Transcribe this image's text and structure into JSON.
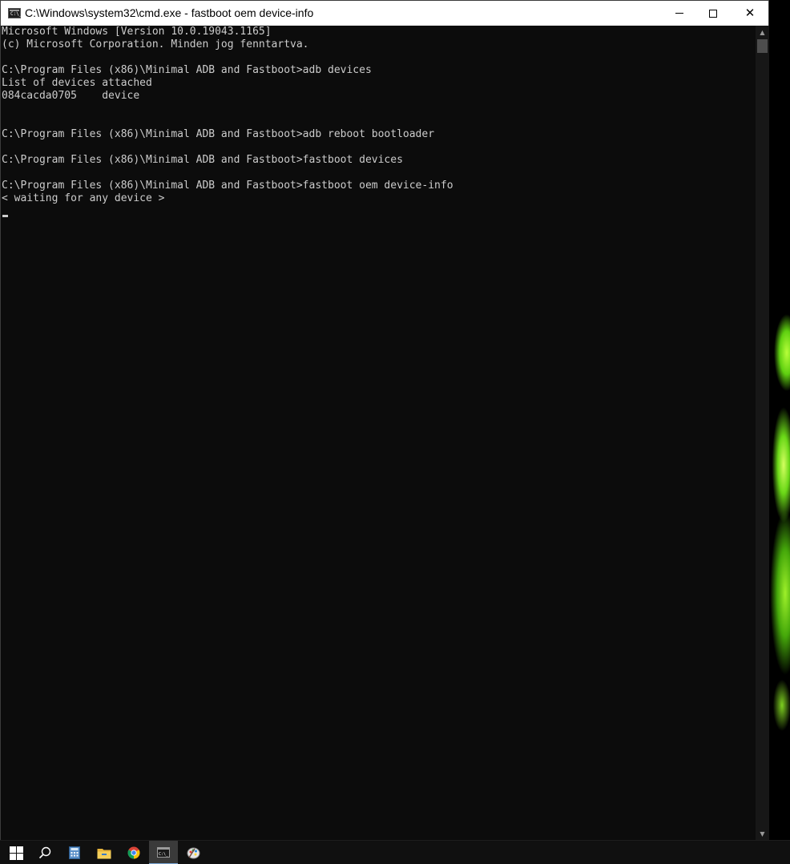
{
  "window": {
    "title": "C:\\Windows\\system32\\cmd.exe - fastboot  oem device-info",
    "app_icon_text": "C:\\_",
    "minimize_glyph": "",
    "close_glyph": "✕"
  },
  "console": {
    "lines": [
      "Microsoft Windows [Version 10.0.19043.1165]",
      "(c) Microsoft Corporation. Minden jog fenntartva.",
      "",
      "C:\\Program Files (x86)\\Minimal ADB and Fastboot>adb devices",
      "List of devices attached",
      "084cacda0705    device",
      "",
      "",
      "C:\\Program Files (x86)\\Minimal ADB and Fastboot>adb reboot bootloader",
      "",
      "C:\\Program Files (x86)\\Minimal ADB and Fastboot>fastboot devices",
      "",
      "C:\\Program Files (x86)\\Minimal ADB and Fastboot>fastboot oem device-info",
      "< waiting for any device >"
    ],
    "text_color": "#cccccc",
    "background": "#0c0c0c"
  },
  "scrollbar": {
    "up_glyph": "▲",
    "down_glyph": "▼"
  },
  "taskbar": {
    "items": [
      {
        "name": "start",
        "icon": "windows-logo-icon"
      },
      {
        "name": "search",
        "icon": "search-icon"
      },
      {
        "name": "calculator",
        "icon": "calculator-icon"
      },
      {
        "name": "file-explorer",
        "icon": "folder-icon"
      },
      {
        "name": "chrome",
        "icon": "chrome-icon"
      },
      {
        "name": "command-prompt",
        "icon": "terminal-icon",
        "active": true
      },
      {
        "name": "paint",
        "icon": "palette-icon"
      }
    ]
  },
  "colors": {
    "accent_underline": "#7aa7d8",
    "wallpaper_green": "#6ad817"
  }
}
